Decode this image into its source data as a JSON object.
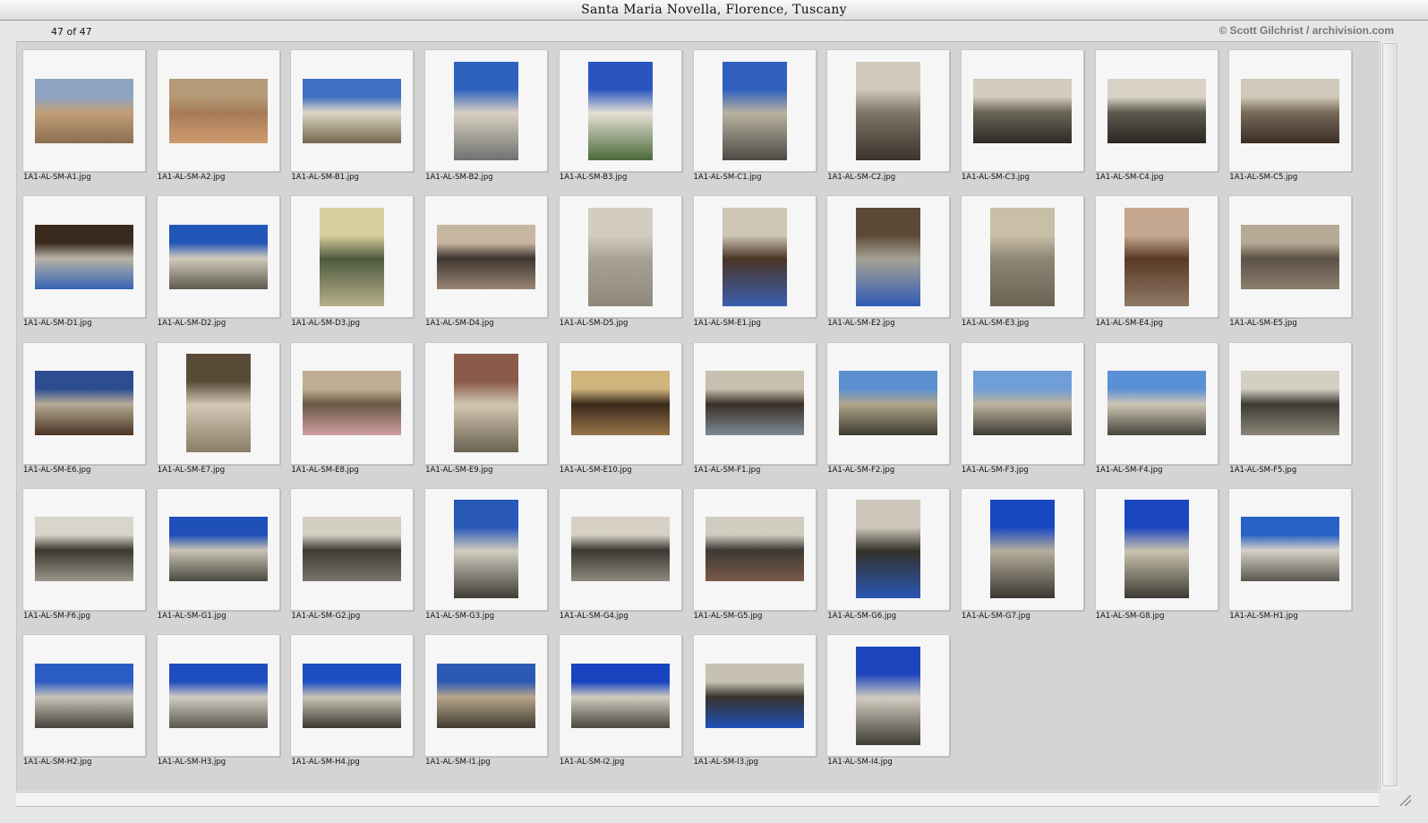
{
  "window": {
    "title": "Santa Maria Novella, Florence, Tuscany"
  },
  "status": {
    "count": "47 of 47",
    "credit": "© Scott Gilchrist / archivision.com"
  },
  "thumbnails": [
    {
      "label": "1A1-AL-SM-A1.jpg",
      "orientation": "landscape",
      "colors": [
        "#8ea3c2",
        "#c2a07a",
        "#8a6e50"
      ]
    },
    {
      "label": "1A1-AL-SM-A2.jpg",
      "orientation": "landscape",
      "colors": [
        "#b59a78",
        "#a77b58",
        "#cf9b6f"
      ]
    },
    {
      "label": "1A1-AL-SM-B1.jpg",
      "orientation": "landscape",
      "colors": [
        "#3f6fc4",
        "#ddd6c4",
        "#746750"
      ]
    },
    {
      "label": "1A1-AL-SM-B2.jpg",
      "orientation": "portrait",
      "colors": [
        "#2e62c0",
        "#d9d1c0",
        "#6f7070"
      ]
    },
    {
      "label": "1A1-AL-SM-B3.jpg",
      "orientation": "portrait",
      "colors": [
        "#2a55c0",
        "#e5e0d4",
        "#4b6a3a"
      ]
    },
    {
      "label": "1A1-AL-SM-C1.jpg",
      "orientation": "portrait",
      "colors": [
        "#2f5fbf",
        "#b8b2a0",
        "#4c4a44"
      ]
    },
    {
      "label": "1A1-AL-SM-C2.jpg",
      "orientation": "portrait",
      "colors": [
        "#cfc9bb",
        "#7d7566",
        "#3a342c"
      ]
    },
    {
      "label": "1A1-AL-SM-C3.jpg",
      "orientation": "landscape",
      "colors": [
        "#d2ccbd",
        "#6b6557",
        "#2d2a24"
      ]
    },
    {
      "label": "1A1-AL-SM-C4.jpg",
      "orientation": "landscape",
      "colors": [
        "#d8d3c6",
        "#5f5a4f",
        "#2a2722"
      ]
    },
    {
      "label": "1A1-AL-SM-C5.jpg",
      "orientation": "landscape",
      "colors": [
        "#d0c8b8",
        "#7a6b5c",
        "#3c2c23"
      ]
    },
    {
      "label": "1A1-AL-SM-D1.jpg",
      "orientation": "landscape",
      "colors": [
        "#3a2a1e",
        "#b9b4a6",
        "#3462b5"
      ]
    },
    {
      "label": "1A1-AL-SM-D2.jpg",
      "orientation": "landscape",
      "colors": [
        "#2255b8",
        "#d1cbba",
        "#5e5a4d"
      ]
    },
    {
      "label": "1A1-AL-SM-D3.jpg",
      "orientation": "portrait",
      "colors": [
        "#d9cf9e",
        "#4d5a3f",
        "#b8b08a"
      ]
    },
    {
      "label": "1A1-AL-SM-D4.jpg",
      "orientation": "landscape",
      "colors": [
        "#c7b6a0",
        "#3e3530",
        "#9a8674"
      ]
    },
    {
      "label": "1A1-AL-SM-D5.jpg",
      "orientation": "portrait",
      "colors": [
        "#d3cdc0",
        "#a8a196",
        "#8f887a"
      ]
    },
    {
      "label": "1A1-AL-SM-E1.jpg",
      "orientation": "portrait",
      "colors": [
        "#cfc6b6",
        "#4a3526",
        "#3b5fb0"
      ]
    },
    {
      "label": "1A1-AL-SM-E2.jpg",
      "orientation": "portrait",
      "colors": [
        "#5c4a38",
        "#a6a294",
        "#2f5ab4"
      ]
    },
    {
      "label": "1A1-AL-SM-E3.jpg",
      "orientation": "portrait",
      "colors": [
        "#c9bfa8",
        "#8e8574",
        "#6a6252"
      ]
    },
    {
      "label": "1A1-AL-SM-E4.jpg",
      "orientation": "portrait",
      "colors": [
        "#c6a890",
        "#5a3a26",
        "#8e7a66"
      ]
    },
    {
      "label": "1A1-AL-SM-E5.jpg",
      "orientation": "landscape",
      "colors": [
        "#b6aa96",
        "#5d5246",
        "#8a7e6e"
      ]
    },
    {
      "label": "1A1-AL-SM-E6.jpg",
      "orientation": "landscape",
      "colors": [
        "#2e4d90",
        "#b5ab96",
        "#4a3324"
      ]
    },
    {
      "label": "1A1-AL-SM-E7.jpg",
      "orientation": "portrait",
      "colors": [
        "#5a4a38",
        "#d2c8b6",
        "#8a7c66"
      ]
    },
    {
      "label": "1A1-AL-SM-E8.jpg",
      "orientation": "landscape",
      "colors": [
        "#bfae92",
        "#6a5844",
        "#cf9fa0"
      ]
    },
    {
      "label": "1A1-AL-SM-E9.jpg",
      "orientation": "portrait",
      "colors": [
        "#8a5b4b",
        "#d1c6b0",
        "#6b6152"
      ]
    },
    {
      "label": "1A1-AL-SM-E10.jpg",
      "orientation": "landscape",
      "colors": [
        "#d0b47c",
        "#3a2a1c",
        "#9a7448"
      ]
    },
    {
      "label": "1A1-AL-SM-F1.jpg",
      "orientation": "landscape",
      "colors": [
        "#c8bfae",
        "#3a2f26",
        "#7d8b96"
      ]
    },
    {
      "label": "1A1-AL-SM-F2.jpg",
      "orientation": "landscape",
      "colors": [
        "#5c8fcf",
        "#b0a48c",
        "#3c3a30"
      ]
    },
    {
      "label": "1A1-AL-SM-F3.jpg",
      "orientation": "landscape",
      "colors": [
        "#6f9ed8",
        "#bdb39e",
        "#3d3b33"
      ]
    },
    {
      "label": "1A1-AL-SM-F4.jpg",
      "orientation": "landscape",
      "colors": [
        "#5a90d6",
        "#cdc6b4",
        "#46433a"
      ]
    },
    {
      "label": "1A1-AL-SM-F5.jpg",
      "orientation": "landscape",
      "colors": [
        "#d3cfc3",
        "#3d3a33",
        "#8c877a"
      ]
    },
    {
      "label": "1A1-AL-SM-F6.jpg",
      "orientation": "landscape",
      "colors": [
        "#d9d5ca",
        "#3a372f",
        "#9c968a"
      ]
    },
    {
      "label": "1A1-AL-SM-G1.jpg",
      "orientation": "landscape",
      "colors": [
        "#1f4fb8",
        "#c9c3b4",
        "#4a4840"
      ]
    },
    {
      "label": "1A1-AL-SM-G2.jpg",
      "orientation": "landscape",
      "colors": [
        "#d4cfc3",
        "#3e3b35",
        "#7a766c"
      ]
    },
    {
      "label": "1A1-AL-SM-G3.jpg",
      "orientation": "portrait",
      "colors": [
        "#2858b8",
        "#d1ccbf",
        "#3f3c35"
      ]
    },
    {
      "label": "1A1-AL-SM-G4.jpg",
      "orientation": "landscape",
      "colors": [
        "#d6d1c4",
        "#3b3832",
        "#8e8a7e"
      ]
    },
    {
      "label": "1A1-AL-SM-G5.jpg",
      "orientation": "landscape",
      "colors": [
        "#d1ccc0",
        "#3c3933",
        "#7b5a4a"
      ]
    },
    {
      "label": "1A1-AL-SM-G6.jpg",
      "orientation": "portrait",
      "colors": [
        "#cdc8bb",
        "#34312b",
        "#2a56b4"
      ]
    },
    {
      "label": "1A1-AL-SM-G7.jpg",
      "orientation": "portrait",
      "colors": [
        "#1a47c2",
        "#b5ae9c",
        "#3a3730"
      ]
    },
    {
      "label": "1A1-AL-SM-G8.jpg",
      "orientation": "portrait",
      "colors": [
        "#1b46c0",
        "#c9c2ae",
        "#3c3a32"
      ]
    },
    {
      "label": "1A1-AL-SM-H1.jpg",
      "orientation": "landscape",
      "colors": [
        "#2962c6",
        "#d6d1c6",
        "#5a574f"
      ]
    },
    {
      "label": "1A1-AL-SM-H2.jpg",
      "orientation": "landscape",
      "colors": [
        "#2a5cc4",
        "#c9c4b8",
        "#45423b"
      ]
    },
    {
      "label": "1A1-AL-SM-H3.jpg",
      "orientation": "landscape",
      "colors": [
        "#1e4dc0",
        "#d1ccc0",
        "#5b574e"
      ]
    },
    {
      "label": "1A1-AL-SM-H4.jpg",
      "orientation": "landscape",
      "colors": [
        "#1b4fc2",
        "#cbc5b6",
        "#3a372f"
      ]
    },
    {
      "label": "1A1-AL-SM-I1.jpg",
      "orientation": "landscape",
      "colors": [
        "#2b5ab4",
        "#b8a58a",
        "#3f3a31"
      ]
    },
    {
      "label": "1A1-AL-SM-I2.jpg",
      "orientation": "landscape",
      "colors": [
        "#1844c0",
        "#d0cbbe",
        "#4a463d"
      ]
    },
    {
      "label": "1A1-AL-SM-I3.jpg",
      "orientation": "landscape",
      "colors": [
        "#c6c1b3",
        "#35322b",
        "#2150b8"
      ]
    },
    {
      "label": "1A1-AL-SM-I4.jpg",
      "orientation": "portrait",
      "colors": [
        "#1e46bc",
        "#d1ccbf",
        "#3f3c35"
      ]
    }
  ]
}
